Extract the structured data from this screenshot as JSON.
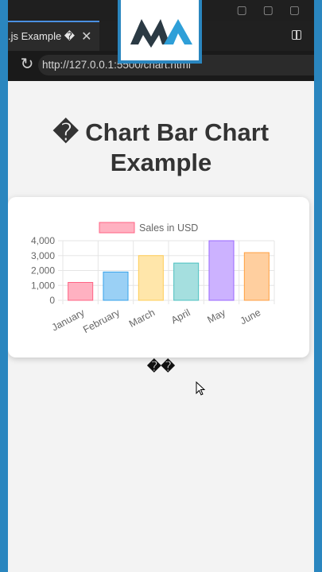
{
  "browser": {
    "tab_label": ".js Example �",
    "tab_close": "✕",
    "url": "http://127.0.0.1:5500/chart.html"
  },
  "logo": {
    "alt": "MA logo",
    "colors": {
      "dark": "#2b3a44",
      "accent": "#2e9fd8"
    }
  },
  "page": {
    "title_line1": "� Chart Bar Chart",
    "title_line2": "Example",
    "below_chart_text": "��"
  },
  "chart_data": {
    "type": "bar",
    "categories": [
      "January",
      "February",
      "March",
      "April",
      "May",
      "June"
    ],
    "series": [
      {
        "name": "Sales in USD",
        "values": [
          1200,
          1900,
          3000,
          2500,
          4000,
          3200
        ]
      }
    ],
    "ylim": [
      0,
      4000
    ],
    "yticks": [
      "0",
      "1,000",
      "2,000",
      "3,000",
      "4,000"
    ],
    "legend": "top",
    "grid": true,
    "colors": {
      "fills": [
        "#ffb1c1",
        "#9ad0f5",
        "#ffe6aa",
        "#a5dfdf",
        "#ccb2ff",
        "#ffcf9f"
      ],
      "borders": [
        "#ff6384",
        "#36a2eb",
        "#ffcd56",
        "#4bc0c0",
        "#9966ff",
        "#ff9f40"
      ],
      "legend_fill": "#ffb1c1",
      "legend_border": "#ff6384"
    }
  }
}
